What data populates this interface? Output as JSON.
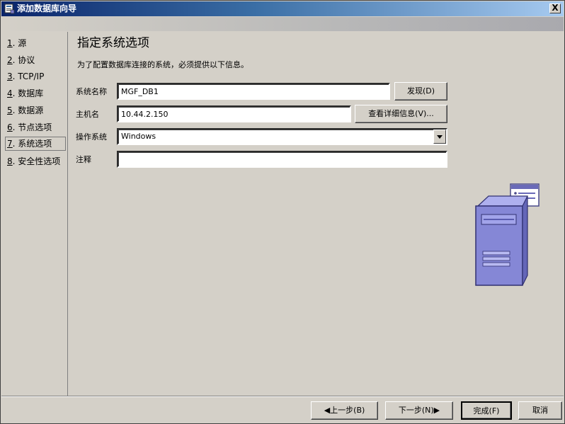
{
  "window": {
    "title": "添加数据库向导",
    "close_glyph": "X",
    "icon": "wizard-icon"
  },
  "steps": [
    {
      "num": "1",
      "label": ". 源"
    },
    {
      "num": "2",
      "label": ". 协议"
    },
    {
      "num": "3",
      "label": ". TCP/IP"
    },
    {
      "num": "4",
      "label": ". 数据库"
    },
    {
      "num": "5",
      "label": ". 数据源"
    },
    {
      "num": "6",
      "label": ". 节点选项"
    },
    {
      "num": "7",
      "label": ". 系统选项"
    },
    {
      "num": "8",
      "label": ". 安全性选项"
    }
  ],
  "active_step": 7,
  "main": {
    "heading": "指定系统选项",
    "description": "为了配置数据库连接的系统，必须提供以下信息。",
    "system_name": {
      "label": "系统名称",
      "value": "MGF_DB1",
      "button": "发现(D)"
    },
    "host_name": {
      "label": "主机名",
      "value": "10.44.2.150",
      "button": "查看详细信息(V)..."
    },
    "os": {
      "label": "操作系统",
      "value": "Windows"
    },
    "comment": {
      "label": "注释",
      "value": ""
    },
    "illustration": "server-icon"
  },
  "footer": {
    "back": "上一步(B)",
    "next": "下一步(N)",
    "finish": "完成(F)",
    "cancel": "取消"
  }
}
